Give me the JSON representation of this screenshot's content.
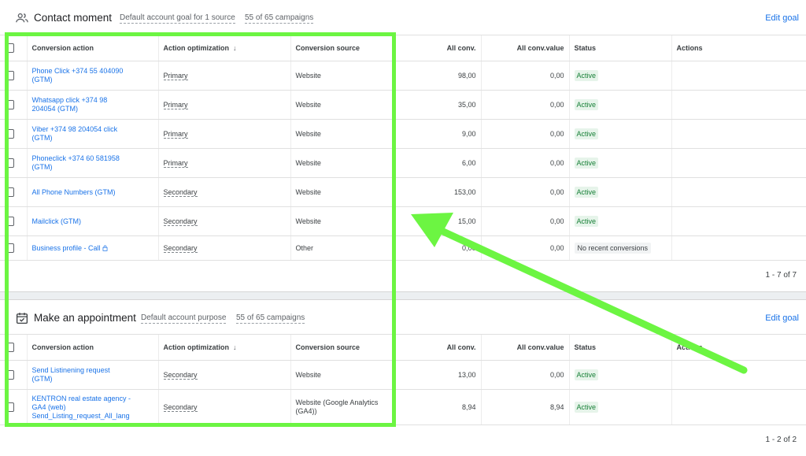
{
  "section1": {
    "title": "Contact moment",
    "goal_text": "Default account goal for 1 source",
    "campaigns_text": "55 of 65 campaigns",
    "edit_label": "Edit goal",
    "icon": "people-icon",
    "pager": "1 - 7 of 7"
  },
  "section2": {
    "title": "Make an appointment",
    "goal_text": "Default account purpose",
    "campaigns_text": "55 of 65 campaigns",
    "edit_label": "Edit goal",
    "icon": "calendar-check-icon",
    "pager": "1 - 2 of 2"
  },
  "columns": {
    "action": "Conversion action",
    "optimization": "Action optimization",
    "source": "Conversion source",
    "all_conv": "All conv.",
    "all_conv_value": "All conv.value",
    "status": "Status",
    "actions": "Actions"
  },
  "rows1": [
    {
      "action_l1": "Phone Click +374 55 404090",
      "action_l2": "(GTM)",
      "optimization": "Primary",
      "source_l1": "Website",
      "source_l2": "",
      "all_conv": "98,00",
      "all_conv_value": "0,00",
      "status": "Active"
    },
    {
      "action_l1": "Whatsapp click +374 98",
      "action_l2": "204054 (GTM)",
      "optimization": "Primary",
      "source_l1": "Website",
      "source_l2": "",
      "all_conv": "35,00",
      "all_conv_value": "0,00",
      "status": "Active"
    },
    {
      "action_l1": "Viber +374 98 204054 click",
      "action_l2": "(GTM)",
      "optimization": "Primary",
      "source_l1": "Website",
      "source_l2": "",
      "all_conv": "9,00",
      "all_conv_value": "0,00",
      "status": "Active"
    },
    {
      "action_l1": "Phoneclick +374 60 581958",
      "action_l2": "(GTM)",
      "optimization": "Primary",
      "source_l1": "Website",
      "source_l2": "",
      "all_conv": "6,00",
      "all_conv_value": "0,00",
      "status": "Active"
    },
    {
      "action_l1": "All Phone Numbers (GTM)",
      "action_l2": "",
      "optimization": "Secondary",
      "source_l1": "Website",
      "source_l2": "",
      "all_conv": "153,00",
      "all_conv_value": "0,00",
      "status": "Active"
    },
    {
      "action_l1": "Mailclick (GTM)",
      "action_l2": "",
      "optimization": "Secondary",
      "source_l1": "Website",
      "source_l2": "",
      "all_conv": "15,00",
      "all_conv_value": "0,00",
      "status": "Active"
    },
    {
      "action_l1": "Business profile - Call",
      "action_l2": "",
      "optimization": "Secondary",
      "source_l1": "Other",
      "source_l2": "",
      "all_conv": "0,00",
      "all_conv_value": "0,00",
      "status": "No recent conversions",
      "locked": true
    }
  ],
  "rows2": [
    {
      "action_l1": "Send Listinening request",
      "action_l2": "(GTM)",
      "action_l3": "",
      "optimization": "Secondary",
      "source_l1": "Website",
      "source_l2": "",
      "all_conv": "13,00",
      "all_conv_value": "0,00",
      "status": "Active"
    },
    {
      "action_l1": "KENTRON real estate agency -",
      "action_l2": "GA4 (web)",
      "action_l3": "Send_Listing_request_All_lang",
      "optimization": "Secondary",
      "source_l1": "Website (Google Analytics",
      "source_l2": "(GA4))",
      "all_conv": "8,94",
      "all_conv_value": "8,94",
      "status": "Active"
    }
  ],
  "colors": {
    "link": "#1a73e8",
    "active_bg": "#e6f4ea",
    "active_text": "#188038",
    "highlight": "#6cf542"
  }
}
